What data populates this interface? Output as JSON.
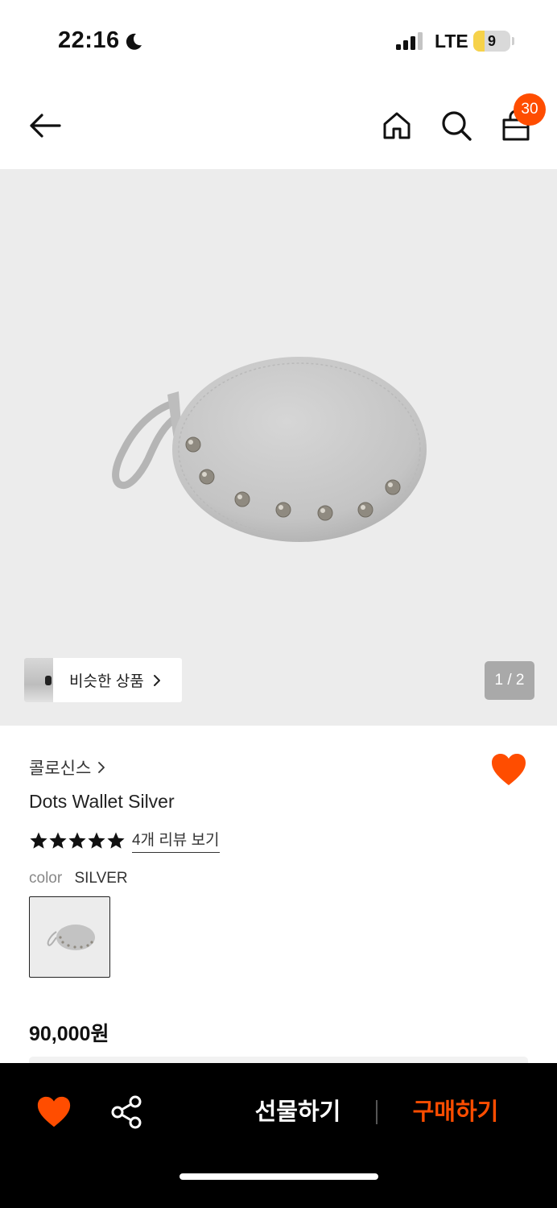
{
  "status_bar": {
    "time": "22:16",
    "network": "LTE",
    "battery": "9",
    "battery_level": 0.3
  },
  "nav": {
    "cart_count": "30",
    "icons": [
      "back-arrow-icon",
      "home-icon",
      "search-icon",
      "shopping-bag-icon"
    ]
  },
  "gallery": {
    "similar_label": "비슷한 상품",
    "pager": "1 / 2"
  },
  "product": {
    "brand": "콜로신스",
    "name": "Dots Wallet Silver",
    "rating_stars": 5,
    "review_link": "4개 리뷰 보기",
    "color_label": "color",
    "color_value": "SILVER",
    "price": "90,000원",
    "liked": true
  },
  "bottom_bar": {
    "gift_label": "선물하기",
    "buy_label": "구매하기"
  },
  "colors": {
    "accent": "#ff4d00",
    "hero_background": "#ececec",
    "bottom_bar": "#000000"
  }
}
